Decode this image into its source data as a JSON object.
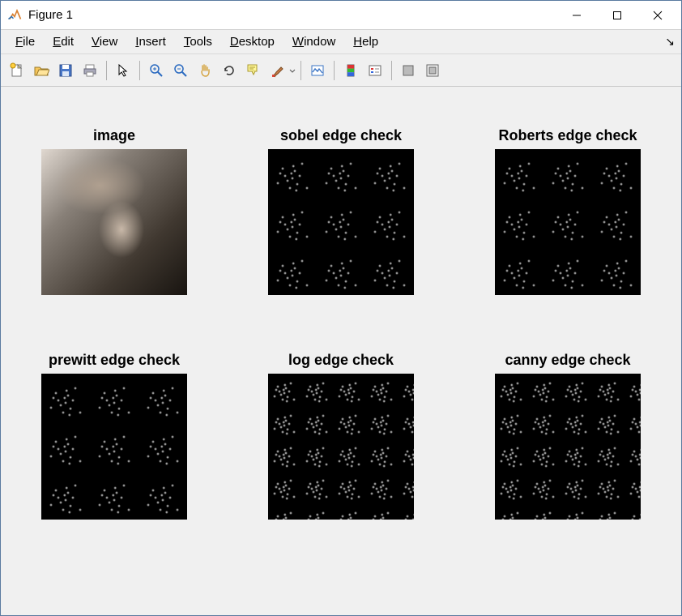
{
  "window": {
    "title": "Figure 1"
  },
  "menu": {
    "file": "File",
    "edit": "Edit",
    "view": "View",
    "insert": "Insert",
    "tools": "Tools",
    "desktop": "Desktop",
    "window": "Window",
    "help": "Help"
  },
  "panels": [
    {
      "title": "image",
      "kind": "gray"
    },
    {
      "title": "sobel edge check",
      "kind": "edge"
    },
    {
      "title": "Roberts edge check",
      "kind": "edge"
    },
    {
      "title": "prewitt edge check",
      "kind": "edge"
    },
    {
      "title": "log edge check",
      "kind": "edge-dense"
    },
    {
      "title": "canny edge check",
      "kind": "edge-dense"
    }
  ]
}
